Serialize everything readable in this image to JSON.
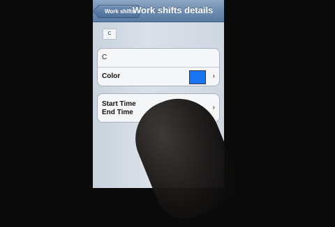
{
  "navbar": {
    "back_label": "Work shifts",
    "title": "Work shifts details"
  },
  "badge": {
    "label": "C"
  },
  "details": {
    "name_value": "C",
    "color_label": "Color",
    "color_value": "#1a73f0",
    "chevron": "›"
  },
  "times": {
    "start_label": "Start Time",
    "end_label": "End Time",
    "chevron": "›"
  }
}
